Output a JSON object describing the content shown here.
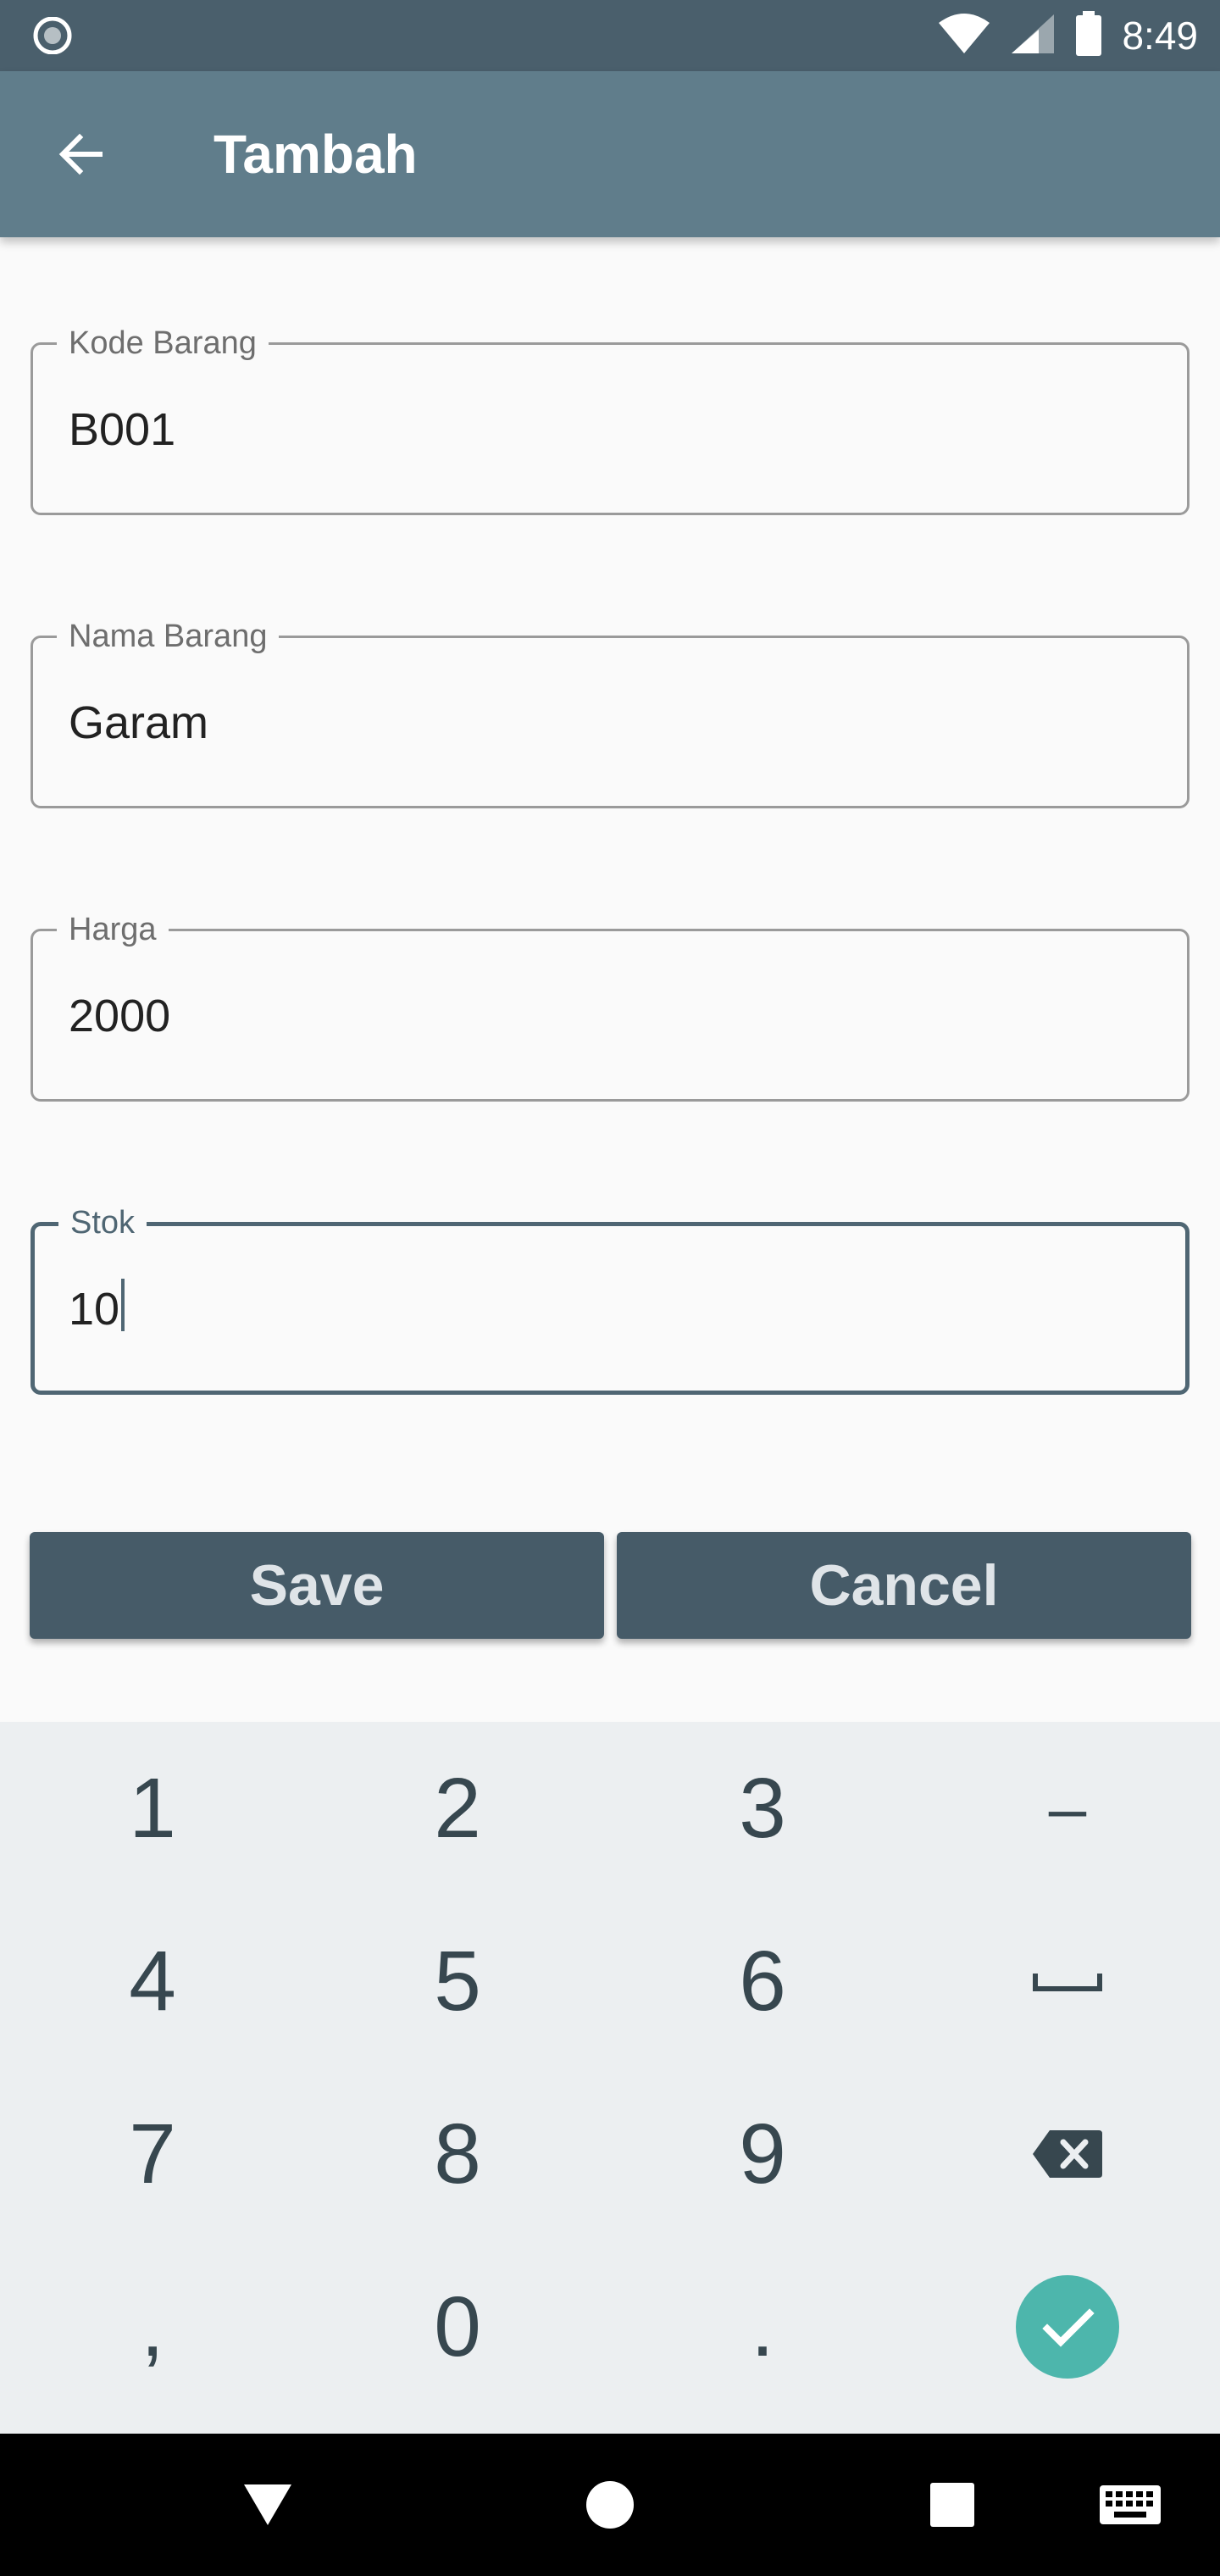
{
  "status_bar": {
    "time": "8:49",
    "icons": [
      "notification-dot-icon",
      "wifi-icon",
      "cell-signal-icon",
      "battery-icon"
    ]
  },
  "app_bar": {
    "title": "Tambah",
    "back_icon": "arrow-left-icon",
    "background": "#607d8b"
  },
  "form": {
    "fields": [
      {
        "label": "Kode Barang",
        "value": "B001",
        "focused": false
      },
      {
        "label": "Nama Barang",
        "value": "Garam",
        "focused": false
      },
      {
        "label": "Harga",
        "value": "2000",
        "focused": false
      },
      {
        "label": "Stok",
        "value": "10",
        "focused": true
      }
    ],
    "save_label": "Save",
    "cancel_label": "Cancel",
    "button_color": "#465b68"
  },
  "keyboard": {
    "keys": [
      [
        "1",
        "2",
        "3",
        "–"
      ],
      [
        "4",
        "5",
        "6",
        "space-icon"
      ],
      [
        "7",
        "8",
        "9",
        "backspace-icon"
      ],
      [
        ",",
        "0",
        ".",
        "done-check-icon"
      ]
    ],
    "accent": "#4db6ac"
  },
  "nav_bar": {
    "buttons": [
      "back-triangle-icon",
      "home-circle-icon",
      "recents-square-icon",
      "keyboard-switch-icon"
    ]
  }
}
